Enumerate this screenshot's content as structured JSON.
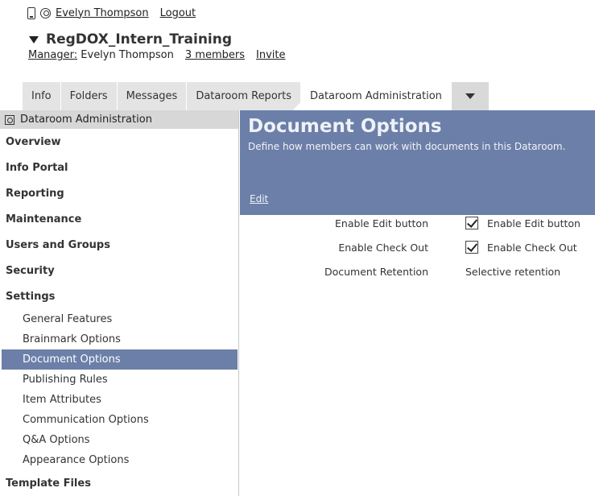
{
  "user": {
    "name": "Evelyn Thompson",
    "logout_label": "Logout"
  },
  "workspace": {
    "title": "RegDOX_Intern_Training",
    "manager_label": "Manager:",
    "manager_name": "Evelyn Thompson",
    "members_label": "3 members",
    "invite_label": "Invite"
  },
  "tabs": [
    {
      "label": "Info"
    },
    {
      "label": "Folders"
    },
    {
      "label": "Messages"
    },
    {
      "label": "Dataroom Reports"
    },
    {
      "label": "Dataroom Administration",
      "active": true
    }
  ],
  "sidebar": {
    "header": "Dataroom Administration",
    "sections": [
      {
        "label": "Overview"
      },
      {
        "label": "Info Portal"
      },
      {
        "label": "Reporting"
      },
      {
        "label": "Maintenance"
      },
      {
        "label": "Users and Groups"
      },
      {
        "label": "Security"
      },
      {
        "label": "Settings"
      }
    ],
    "settings_items": [
      {
        "label": "General Features"
      },
      {
        "label": "Brainmark Options"
      },
      {
        "label": "Document Options",
        "selected": true
      },
      {
        "label": "Publishing Rules"
      },
      {
        "label": "Item Attributes"
      },
      {
        "label": "Communication Options"
      },
      {
        "label": "Q&A Options"
      },
      {
        "label": "Appearance Options"
      }
    ],
    "after_section": "Template Files"
  },
  "main": {
    "title": "Document Options",
    "description": "Define how members can work with documents in this Dataroom.",
    "edit_label": "Edit",
    "options": [
      {
        "label": "Enable Edit button",
        "value": "Enable Edit button",
        "checked": true
      },
      {
        "label": "Enable Check Out",
        "value": "Enable Check Out",
        "checked": true
      },
      {
        "label": "Document Retention",
        "value": "Selective retention"
      }
    ]
  },
  "colors": {
    "accent": "#6b7fa8",
    "tab_bg": "#e4e4e4",
    "sidebar_header_bg": "#d7d7d7"
  }
}
